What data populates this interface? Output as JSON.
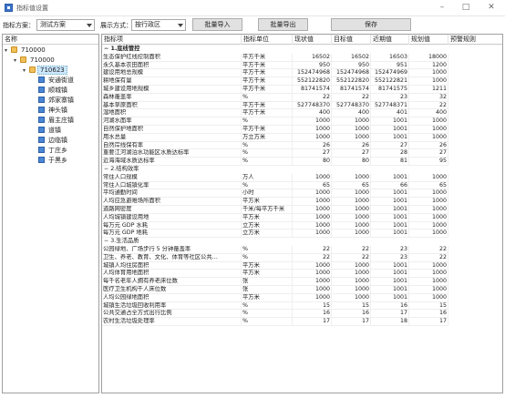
{
  "window": {
    "title": "指标值设置",
    "minimize": "–",
    "maximize": "□",
    "close": "✕"
  },
  "toolbar": {
    "plan_label": "指标方案：",
    "plan_value": "测试方案",
    "display_label": "展示方式：",
    "display_value": "按行政区",
    "import_label": "批量导入",
    "export_label": "批量导出",
    "save_label": "保存"
  },
  "tree": {
    "header": "名称",
    "root": "710000",
    "child": "710000",
    "selected": "710623",
    "leaves": [
      "安通街道",
      "顺城镇",
      "郊家寨镇",
      "神头镇",
      "眉主庄镇",
      "道镇",
      "边临镇",
      "丁庄乡",
      "于黑乡"
    ]
  },
  "grid": {
    "headers": [
      "指标项",
      "指标单位",
      "现状值",
      "目标值",
      "近期值",
      "规划值",
      "预警规则"
    ],
    "groups": [
      {
        "title": "1.底线管控",
        "rows": [
          {
            "name": "生态保护红线控制面积",
            "unit": "平方千米",
            "v": [
              "16502",
              "16502",
              "16503",
              "18000"
            ]
          },
          {
            "name": "永久基本农田面积",
            "unit": "平方千米",
            "v": [
              "950",
              "950",
              "951",
              "1200"
            ]
          },
          {
            "name": "建设用地总规模",
            "unit": "平方千米",
            "v": [
              "152474968",
              "152474968",
              "152474969",
              "1000"
            ]
          },
          {
            "name": "耕地保有量",
            "unit": "平方千米",
            "v": [
              "552122820",
              "552122820",
              "552122821",
              "1000"
            ]
          },
          {
            "name": "城乡建设用地规模",
            "unit": "平方千米",
            "v": [
              "81741574",
              "81741574",
              "81741575",
              "1211"
            ]
          },
          {
            "name": "森林覆盖率",
            "unit": "%",
            "v": [
              "22",
              "22",
              "23",
              "32"
            ]
          },
          {
            "name": "基本草原面积",
            "unit": "平方千米",
            "v": [
              "527748370",
              "527748370",
              "527748371",
              "22"
            ]
          },
          {
            "name": "湿地面积",
            "unit": "平方千米",
            "v": [
              "400",
              "400",
              "401",
              "400"
            ]
          },
          {
            "name": "河湖水面率",
            "unit": "%",
            "v": [
              "1000",
              "1000",
              "1001",
              "1000"
            ]
          },
          {
            "name": "自然保护地面积",
            "unit": "平方千米",
            "v": [
              "1000",
              "1000",
              "1001",
              "1000"
            ]
          },
          {
            "name": "用水总量",
            "unit": "万立方米",
            "v": [
              "1000",
              "1000",
              "1001",
              "1000"
            ]
          },
          {
            "name": "自然岸线保有率",
            "unit": "%",
            "v": [
              "26",
              "26",
              "27",
              "26"
            ]
          },
          {
            "name": "重要江河湖泊水功能区水质达标率",
            "unit": "%",
            "v": [
              "27",
              "27",
              "28",
              "27"
            ]
          },
          {
            "name": "近海海域水质达标率",
            "unit": "%",
            "v": [
              "80",
              "80",
              "81",
              "95"
            ]
          }
        ]
      },
      {
        "title": "2.结构效率",
        "rows": [
          {
            "name": "常住人口规模",
            "unit": "万人",
            "v": [
              "1000",
              "1000",
              "1001",
              "1000"
            ]
          },
          {
            "name": "常住人口城镇化率",
            "unit": "%",
            "v": [
              "65",
              "65",
              "66",
              "65"
            ]
          },
          {
            "name": "平均通勤时间",
            "unit": "小时",
            "v": [
              "1000",
              "1000",
              "1001",
              "1000"
            ]
          },
          {
            "name": "人均应急避难场所面积",
            "unit": "平方米",
            "v": [
              "1000",
              "1000",
              "1001",
              "1000"
            ]
          },
          {
            "name": "道路网密度",
            "unit": "千米/每平方千米",
            "v": [
              "1000",
              "1000",
              "1001",
              "1000"
            ]
          },
          {
            "name": "人均城镇建设用地",
            "unit": "平方米",
            "v": [
              "1000",
              "1000",
              "1001",
              "1000"
            ]
          },
          {
            "name": "每万元 GDP 水耗",
            "unit": "立方米",
            "v": [
              "1000",
              "1000",
              "1001",
              "1000"
            ]
          },
          {
            "name": "每万元 GDP 地耗",
            "unit": "立方米",
            "v": [
              "1000",
              "1000",
              "1001",
              "1000"
            ]
          }
        ]
      },
      {
        "title": "3.生活品质",
        "rows": [
          {
            "name": "公园绿地、广场步行 5 分钟覆盖率",
            "unit": "%",
            "v": [
              "22",
              "22",
              "23",
              "22"
            ]
          },
          {
            "name": "卫生、养老、教育、文化、体育等社区公共…",
            "unit": "%",
            "v": [
              "22",
              "22",
              "23",
              "22"
            ]
          },
          {
            "name": "城镇人均住房面积",
            "unit": "平方米",
            "v": [
              "1000",
              "1000",
              "1001",
              "1000"
            ]
          },
          {
            "name": "人均体育用地面积",
            "unit": "平方米",
            "v": [
              "1000",
              "1000",
              "1001",
              "1000"
            ]
          },
          {
            "name": "每千名老年人拥有养老床位数",
            "unit": "张",
            "v": [
              "1000",
              "1000",
              "1001",
              "1000"
            ]
          },
          {
            "name": "医疗卫生机构千人床位数",
            "unit": "张",
            "v": [
              "1000",
              "1000",
              "1001",
              "1000"
            ]
          },
          {
            "name": "人均公园绿地面积",
            "unit": "平方米",
            "v": [
              "1000",
              "1000",
              "1001",
              "1000"
            ]
          },
          {
            "name": "城镇生活垃圾回收利用率",
            "unit": "%",
            "v": [
              "15",
              "15",
              "16",
              "15"
            ]
          },
          {
            "name": "公共交通占全方式出行比例",
            "unit": "%",
            "v": [
              "16",
              "16",
              "17",
              "16"
            ]
          },
          {
            "name": "农村生活垃圾处理率",
            "unit": "%",
            "v": [
              "17",
              "17",
              "18",
              "17"
            ]
          }
        ]
      }
    ]
  }
}
